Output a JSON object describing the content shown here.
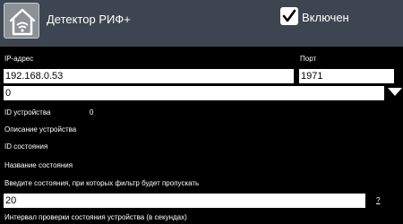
{
  "header": {
    "title": "Детектор РИФ+",
    "enabled_label": "Включен",
    "enabled_checked": true
  },
  "form": {
    "ip_label": "IP-адрес",
    "ip_value": "192.168.0.53",
    "port_label": "Порт",
    "port_value": "1971",
    "device_select_value": "0",
    "device_id_label": "ID устройства",
    "device_id_value": "0",
    "device_description_label": "Описание устройства",
    "state_id_label": "ID состояния",
    "state_name_label": "Название состояния",
    "pass_states_label": "Введите состояния, при которых фильтр будет пропускать",
    "pass_states_value": "20",
    "help_link": "?",
    "check_interval_label": "Интервал проверки состояния устройства (в секундах)"
  },
  "icons": {
    "app": "home-wifi-icon",
    "checkbox": "checkmark-icon",
    "dropdown": "triangle-down-icon"
  }
}
